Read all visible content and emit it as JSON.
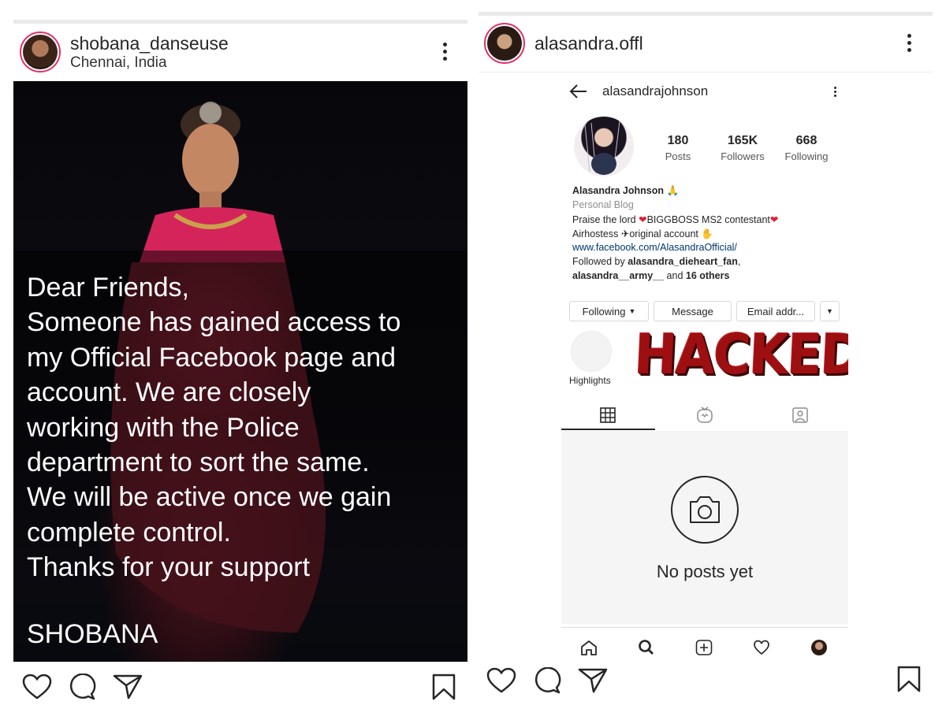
{
  "left_post": {
    "username": "shobana_danseuse",
    "location": "Chennai, India",
    "message": "Dear Friends,\nSomeone has gained access to\nmy Official Facebook page and\naccount. We are closely\nworking with the Police\ndepartment to sort the same.\nWe will be active once we gain\ncomplete control.\nThanks for your support",
    "signature": "SHOBANA",
    "actions": [
      "heart-icon",
      "comment-icon",
      "share-icon",
      "bookmark-icon"
    ]
  },
  "right_post": {
    "username": "alasandra.offl",
    "embedded_profile": {
      "handle": "alasandrajohnson",
      "stats": [
        {
          "value": "180",
          "label": "Posts"
        },
        {
          "value": "165K",
          "label": "Followers"
        },
        {
          "value": "668",
          "label": "Following"
        }
      ],
      "name": "Alasandra Johnson",
      "category": "Personal Blog",
      "bio_line1": "Praise the lord",
      "bio_line1b": "BIGGBOSS MS2 contestant",
      "bio_line2a": "Airhostess",
      "bio_line2b": "original account",
      "link": "www.facebook.com/AlasandraOfficial/",
      "followed_by_prefix": "Followed by ",
      "followed_by_user1": "alasandra_dieheart_fan",
      "followed_by_user2": "alasandra__army__",
      "followed_by_and": " and ",
      "followed_by_others": "16 others",
      "buttons": {
        "following": "Following",
        "message": "Message",
        "email": "Email addr..."
      },
      "highlights_label": "Highlights",
      "hacked_stamp": "HACKED",
      "empty_state": "No posts yet"
    },
    "actions": [
      "heart-icon",
      "comment-icon",
      "share-icon",
      "bookmark-icon"
    ]
  },
  "colors": {
    "heart": "#e0203a",
    "link": "#00376b",
    "stamp": "#9e0f12"
  }
}
